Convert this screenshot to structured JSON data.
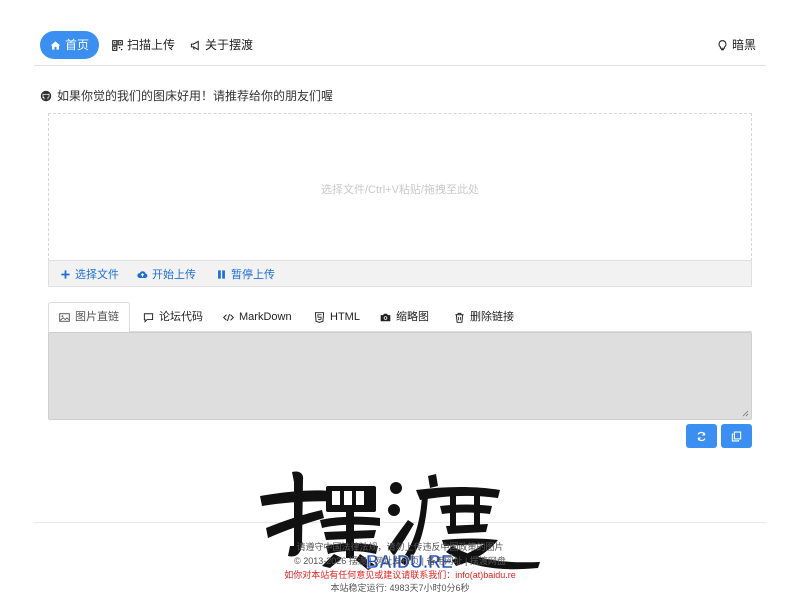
{
  "nav": {
    "home": "首页",
    "scan_upload": "扫描上传",
    "about": "关于摆渡",
    "theme": "暗黑"
  },
  "recommend": {
    "text": "如果你觉的我们的图床好用！请推荐给你的朋友们喔"
  },
  "upload": {
    "hint": "选择文件/Ctrl+V粘贴/拖拽至此处",
    "select_label": "选择文件",
    "start_label": "开始上传",
    "pause_label": "暂停上传"
  },
  "tabs": [
    {
      "label": "图片直链"
    },
    {
      "label": "论坛代码"
    },
    {
      "label": "MarkDown"
    },
    {
      "label": "HTML"
    },
    {
      "label": "缩略图"
    },
    {
      "label": "删除链接"
    }
  ],
  "output": {
    "value": ""
  },
  "logo": {
    "chars": "摆渡",
    "site": "BAIDU.RE"
  },
  "footer": {
    "line1": "请遵守中国法律法规，请勿上传违反中国政策的图片",
    "line2": "© 2013-2026 摆渡 | 网址发布页 | 备用网址 | 摆渡网盘",
    "line3": "如你对本站有任何意见或建议请联系我们：info(at)baidu.re",
    "line4": "本站稳定运行: 4983天7小时0分6秒"
  },
  "colors": {
    "accent": "#3b8ff0",
    "link": "#1f6fd6",
    "warning": "#e02020"
  },
  "icons": [
    "home-icon",
    "qrcode-icon",
    "bullhorn-icon",
    "lightbulb-icon",
    "github-icon",
    "plus-icon",
    "cloud-upload-icon",
    "pause-icon",
    "image-icon",
    "comment-icon",
    "code-icon",
    "html5-icon",
    "camera-icon",
    "trash-icon",
    "refresh-icon",
    "copy-icon"
  ]
}
